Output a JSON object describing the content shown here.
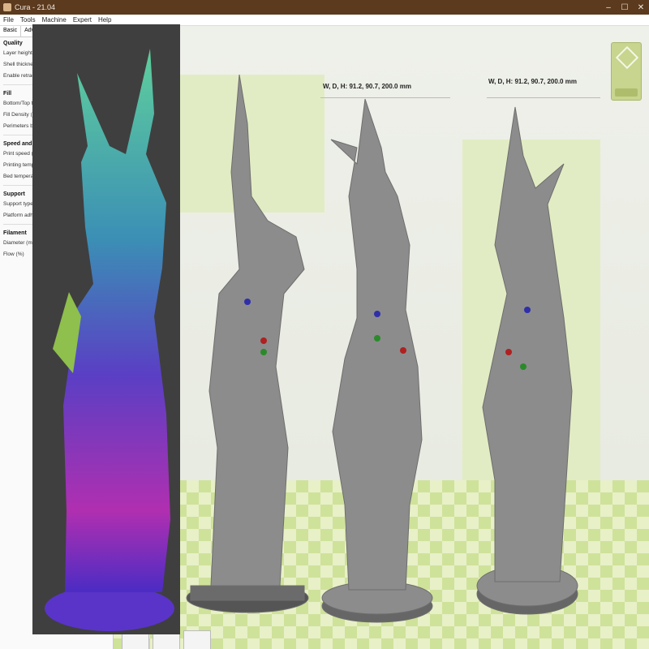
{
  "window": {
    "title": "Cura - 21.04",
    "buttons": [
      "–",
      "☐",
      "✕"
    ]
  },
  "menu": [
    "File",
    "Tools",
    "Machine",
    "Expert",
    "Help"
  ],
  "panel": {
    "tabs": [
      "Basic",
      "Advanced"
    ],
    "sections": [
      {
        "title": "Quality",
        "rows": [
          "Layer height (m",
          "Shell thickness",
          "Enable retractio"
        ]
      },
      {
        "title": "Fill",
        "rows": [
          "Bottom/Top thi",
          "Fill Density (%)",
          "Perimeters befo"
        ]
      },
      {
        "title": "Speed and Temp",
        "rows": [
          "Print speed (mr",
          "Printing tempe",
          "Bed temperatu"
        ]
      },
      {
        "title": "Support",
        "rows": [
          "Support type",
          "Platform adhes"
        ]
      },
      {
        "title": "Filament",
        "rows": [
          "Diameter (mm)",
          "Flow (%)"
        ]
      }
    ]
  },
  "viewport": {
    "dimension_labels": [
      "W, D, H: 91.2, 90.7, 200.0 mm",
      "W, D, H: 91.2, 90.7, 200.0 mm"
    ],
    "icons": [
      "view-cube-icon"
    ],
    "colors": {
      "floor": "#e8f0c8",
      "model": "#8c8c8c",
      "wall": "#e2ecc4"
    }
  }
}
